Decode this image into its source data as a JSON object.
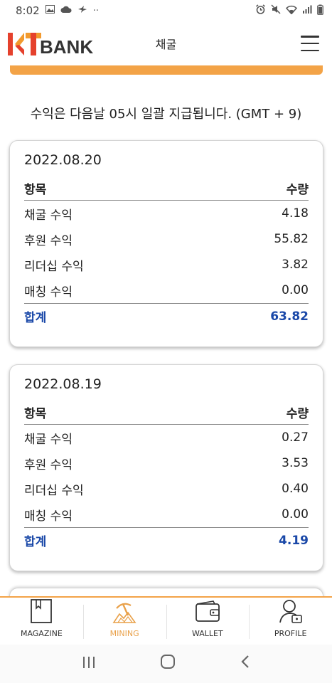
{
  "status_bar": {
    "time": "8:02",
    "left_icons": [
      "image-icon",
      "cloud-icon",
      "bird-icon",
      "more-dots-icon"
    ],
    "right_icons": [
      "alarm-icon",
      "mute-icon",
      "wifi-icon",
      "signal-icon",
      "battery-icon"
    ],
    "more_dots": "··"
  },
  "header": {
    "logo_text": "BANK",
    "title": "채굴"
  },
  "notice": "수익은 다음날 05시 일괄 지급됩니다. (GMT + 9)",
  "table_headers": {
    "item": "항목",
    "amount": "수량"
  },
  "cards": [
    {
      "date": "2022.08.20",
      "rows": [
        {
          "label": "채굴 수익",
          "value": "4.18"
        },
        {
          "label": "후원 수익",
          "value": "55.82"
        },
        {
          "label": "리더십 수익",
          "value": "3.82"
        },
        {
          "label": "매칭 수익",
          "value": "0.00"
        }
      ],
      "total_label": "합계",
      "total_value": "63.82"
    },
    {
      "date": "2022.08.19",
      "rows": [
        {
          "label": "채굴 수익",
          "value": "0.27"
        },
        {
          "label": "후원 수익",
          "value": "3.53"
        },
        {
          "label": "리더십 수익",
          "value": "0.40"
        },
        {
          "label": "매칭 수익",
          "value": "0.00"
        }
      ],
      "total_label": "합계",
      "total_value": "4.19"
    }
  ],
  "bottom_nav": [
    {
      "label": "MAGAZINE",
      "icon": "magazine-icon",
      "active": false
    },
    {
      "label": "MINING",
      "icon": "mining-icon",
      "active": true
    },
    {
      "label": "WALLET",
      "icon": "wallet-icon",
      "active": false
    },
    {
      "label": "PROFILE",
      "icon": "profile-icon",
      "active": false
    }
  ],
  "colors": {
    "accent": "#f3a347",
    "total": "#1a48a8",
    "logo_red": "#e5412d",
    "logo_orange": "#f29a2e"
  }
}
